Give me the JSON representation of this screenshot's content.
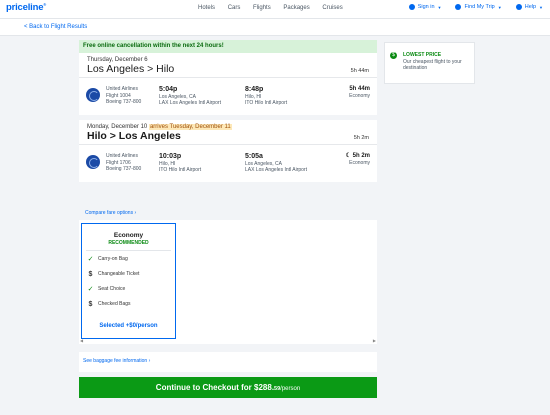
{
  "brand": "priceline",
  "nav": [
    "Hotels",
    "Cars",
    "Flights",
    "Packages",
    "Cruises"
  ],
  "top_right": {
    "sign_in": "Sign in",
    "find_trip": "Find My Trip",
    "help": "Help"
  },
  "back_link": "< Back to Flight Results",
  "cancel_banner": "Free online cancellation within the next 24 hours!",
  "trips": [
    {
      "date": "Thursday, December 6",
      "date_extra": "",
      "route": "Los Angeles > Hilo",
      "duration": "5h 44m",
      "segment": {
        "airline": "United Airlines",
        "flight": "Flight 1004",
        "aircraft": "Boeing 737-800",
        "dep_time": "5:04p",
        "dep_city": "Los Angeles, CA",
        "dep_airport": "LAX Los Angeles Intl Airport",
        "arr_time": "8:48p",
        "arr_city": "Hilo, HI",
        "arr_airport": "ITO Hilo Intl Airport",
        "duration": "5h 44m",
        "cabin": "Economy"
      }
    },
    {
      "date": "Monday, December 10",
      "date_extra": "arrives Tuesday, December 11",
      "route": "Hilo > Los Angeles",
      "duration": "5h 2m",
      "segment": {
        "airline": "United Airlines",
        "flight": "Flight 1706",
        "aircraft": "Boeing 737-800",
        "dep_time": "10:03p",
        "dep_city": "Hilo, HI",
        "dep_airport": "ITO Hilo Intl Airport",
        "arr_time": "5:05a",
        "arr_city": "Los Angeles, CA",
        "arr_airport": "LAX Los Angeles Intl Airport",
        "duration": "5h 2m",
        "cabin": "Economy"
      }
    }
  ],
  "compare_link": "Compare fare options",
  "fare": {
    "title": "Economy",
    "badge": "RECOMMENDED",
    "features": [
      {
        "icon": "check-icon",
        "label": "Carry-on Bag"
      },
      {
        "icon": "dollar-icon",
        "label": "Changeable Ticket"
      },
      {
        "icon": "check-icon",
        "label": "Seat Choice"
      },
      {
        "icon": "dollar-icon",
        "label": "Checked Bags"
      }
    ],
    "selected": "Selected +$0/person"
  },
  "baggage_link": "See baggage fee information",
  "checkout": {
    "label": "Continue to Checkout for ",
    "price": "$288.",
    "cents": "59",
    "per": "/person"
  },
  "lowest_price": {
    "title": "LOWEST PRICE",
    "subtitle": "Our cheapest flight to your destination"
  },
  "colors": {
    "brand_blue": "#0068ef",
    "checkout_green": "#0b9a15",
    "banner_green": "#d7f2d9",
    "airline_blue": "#1b4aa6"
  }
}
